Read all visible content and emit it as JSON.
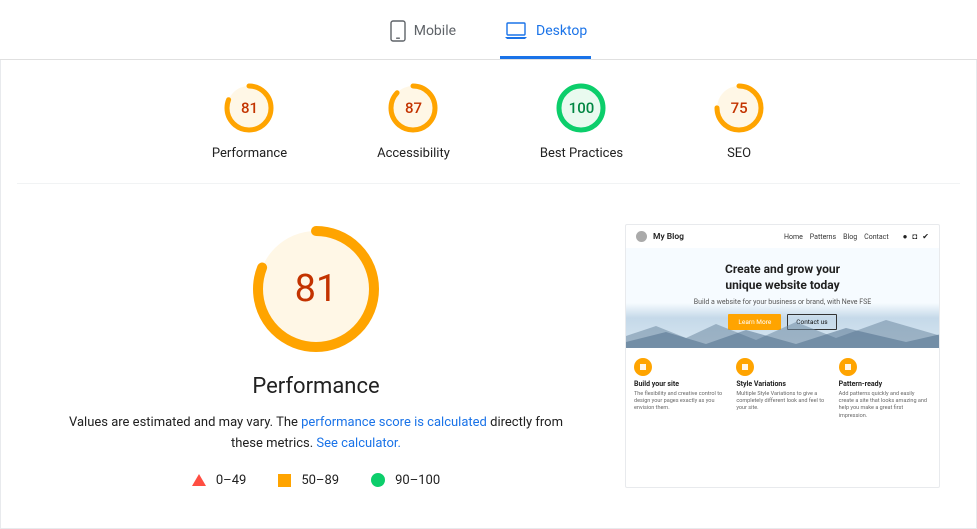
{
  "tabs": {
    "mobile": "Mobile",
    "desktop": "Desktop"
  },
  "gauges": [
    {
      "label": "Performance",
      "score": 81,
      "color": "#ffa400",
      "bg": "#fff7e6",
      "text": "#c33300"
    },
    {
      "label": "Accessibility",
      "score": 87,
      "color": "#ffa400",
      "bg": "#fff7e6",
      "text": "#c33300"
    },
    {
      "label": "Best Practices",
      "score": 100,
      "color": "#0cce6b",
      "bg": "#e9faef",
      "text": "#018642"
    },
    {
      "label": "SEO",
      "score": 75,
      "color": "#ffa400",
      "bg": "#fff7e6",
      "text": "#c33300"
    }
  ],
  "main": {
    "score": 81,
    "title": "Performance",
    "desc_pre": "Values are estimated and may vary. The ",
    "link1": "performance score is calculated",
    "desc_mid": " directly from these metrics. ",
    "link2": "See calculator.",
    "legend": {
      "bad": "0–49",
      "avg": "50–89",
      "good": "90–100"
    }
  },
  "preview": {
    "site": "My Blog",
    "nav": [
      "Home",
      "Patterns",
      "Blog",
      "Contact"
    ],
    "hero_l1": "Create and grow your",
    "hero_l2": "unique website today",
    "hero_sub": "Build a website for your business or brand, with Neve FSE",
    "btn1": "Learn More",
    "btn2": "Contact us",
    "feats": [
      {
        "t": "Build your site",
        "d": "The flexibility and creative control to design your pages exactly as you envision them."
      },
      {
        "t": "Style Variations",
        "d": "Multiple Style Variations to give a completely different look and feel to your site."
      },
      {
        "t": "Pattern-ready",
        "d": "Add patterns quickly and easily create a site that looks amazing and help you make a great first impression."
      }
    ]
  }
}
